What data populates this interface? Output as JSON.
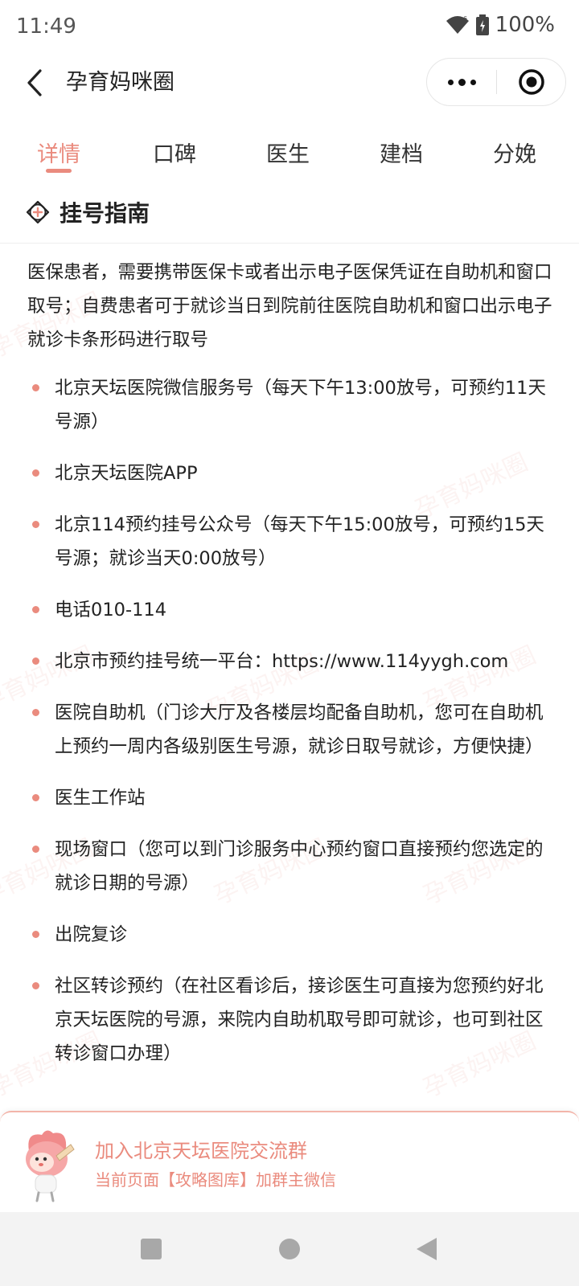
{
  "status_bar": {
    "time": "11:49",
    "battery": "100%",
    "network": "6"
  },
  "header": {
    "title": "孕育妈咪圈"
  },
  "tabs": [
    {
      "label": "详情",
      "active": true
    },
    {
      "label": "口碑",
      "active": false
    },
    {
      "label": "医生",
      "active": false
    },
    {
      "label": "建档",
      "active": false
    },
    {
      "label": "分娩",
      "active": false
    }
  ],
  "section": {
    "title": "挂号指南"
  },
  "content": {
    "intro": "医保患者，需要携带医保卡或者出示电子医保凭证在自助机和窗口取号；自费患者可于就诊当日到院前往医院自助机和窗口出示电子就诊卡条形码进行取号",
    "items": [
      "北京天坛医院微信服务号（每天下午13:00放号，可预约11天号源）",
      "北京天坛医院APP",
      "北京114预约挂号公众号（每天下午15:00放号，可预约15天号源；就诊当天0:00放号）",
      "电话010-114",
      "北京市预约挂号统一平台：https://www.114yygh.com",
      "医院自助机（门诊大厅及各楼层均配备自助机，您可在自助机上预约一周内各级别医生号源，就诊日取号就诊，方便快捷）",
      "医生工作站",
      "现场窗口（您可以到门诊服务中心预约窗口直接预约您选定的就诊日期的号源）",
      "出院复诊",
      "社区转诊预约（在社区看诊后，接诊医生可直接为您预约好北京天坛医院的号源，来院内自助机取号即可就诊，也可到社区转诊窗口办理）"
    ]
  },
  "watermark": "孕育妈咪圈",
  "banner": {
    "title": "加入北京天坛医院交流群",
    "subtitle": "当前页面【攻略图库】加群主微信"
  },
  "colors": {
    "accent": "#ea8b7e",
    "text": "#222222",
    "navbar": "#f3f3f3"
  }
}
